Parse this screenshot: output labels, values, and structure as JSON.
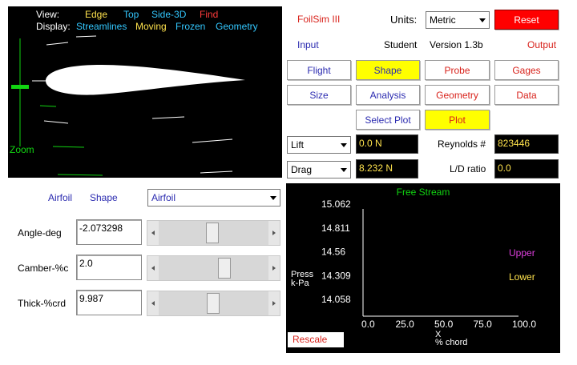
{
  "view_panel": {
    "view_label": "View:",
    "view_options": [
      {
        "label": "Edge",
        "color": "#ffe34d"
      },
      {
        "label": "Top",
        "color": "#33c8ff"
      },
      {
        "label": "Side-3D",
        "color": "#33c8ff"
      },
      {
        "label": "Find",
        "color": "#ff3b3b"
      }
    ],
    "display_label": "Display:",
    "display_options": [
      {
        "label": "Streamlines",
        "color": "#33c8ff"
      },
      {
        "label": "Moving",
        "color": "#ffe34d"
      },
      {
        "label": "Frozen",
        "color": "#33c8ff"
      },
      {
        "label": "Geometry",
        "color": "#33c8ff"
      }
    ],
    "zoom_label": "Zoom"
  },
  "header": {
    "app_name": "FoilSim III",
    "units_label": "Units:",
    "units_value": "Metric",
    "reset_label": "Reset",
    "input_label": "Input",
    "student_label": "Student",
    "version_label": "Version 1.3b",
    "output_label": "Output"
  },
  "buttons": {
    "flight": "Flight",
    "shape": "Shape",
    "probe": "Probe",
    "gages": "Gages",
    "size": "Size",
    "analysis": "Analysis",
    "geometry": "Geometry",
    "data": "Data",
    "select_plot": "Select Plot",
    "plot": "Plot"
  },
  "outputs": {
    "lift_select": "Lift",
    "lift_value": "0.0 N",
    "drag_select": "Drag",
    "drag_value": "8.232 N",
    "reynolds_label": "Reynolds #",
    "reynolds_value": "823446",
    "ld_label": "L/D ratio",
    "ld_value": "0.0"
  },
  "shape_panel": {
    "airfoil_label": "Airfoil",
    "shape_label": "Shape",
    "type_select": "Airfoil",
    "rows": [
      {
        "label": "Angle-deg",
        "value": "-2.073298",
        "slider_fraction": 0.48
      },
      {
        "label": "Camber-%c",
        "value": "2.0",
        "slider_fraction": 0.6
      },
      {
        "label": "Thick-%crd",
        "value": "9.987",
        "slider_fraction": 0.49
      }
    ]
  },
  "chart_data": {
    "type": "line",
    "title": "Free Stream",
    "ylabel_line1": "Press",
    "ylabel_line2": "k-Pa",
    "xlabel_line1": "X",
    "xlabel_line2": "% chord",
    "y_ticks": [
      "15.062",
      "14.811",
      "14.56",
      "14.309",
      "14.058"
    ],
    "x_ticks": [
      "0.0",
      "25.0",
      "50.0",
      "75.0",
      "100.0"
    ],
    "xlim": [
      0,
      100
    ],
    "ylim": [
      14.058,
      15.062
    ],
    "series": [
      {
        "name": "Upper",
        "color": "#e040e0",
        "values": []
      },
      {
        "name": "Lower",
        "color": "#ffe34d",
        "values": []
      }
    ],
    "rescale_label": "Rescale"
  }
}
